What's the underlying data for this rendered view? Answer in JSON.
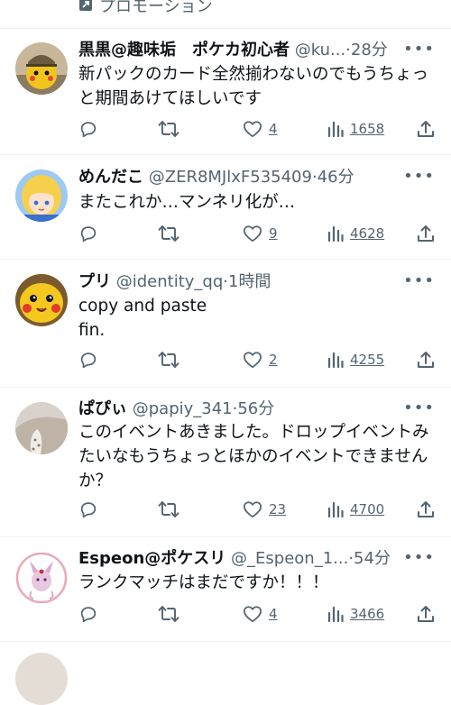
{
  "promo": {
    "label": "プロモーション"
  },
  "tweets": [
    {
      "name": "黒黒@趣味垢　ポケカ初心者",
      "meta": "@ku...·28分",
      "text": "新パックのカード全然揃わないのでもうちょっ\nと期間あけてほしいです",
      "likes": "4",
      "views": "1658",
      "avatar": "pikachu-plush"
    },
    {
      "name": "めんだこ",
      "meta": "@ZER8MJlxF535409·46分",
      "text": "またこれか…マンネリ化が…",
      "likes": "9",
      "views": "4628",
      "avatar": "anime-girl"
    },
    {
      "name": "プリ",
      "meta": "@identity_qq·1時間",
      "text": "copy and paste\nfin.",
      "likes": "2",
      "views": "4255",
      "avatar": "pikachu-face"
    },
    {
      "name": "ぱぴぃ",
      "meta": "@papiy_341·56分",
      "text": "このイベントあきました。ドロップイベントみ\nたいなもうちょっとほかのイベントできません\nか？",
      "likes": "23",
      "views": "4700",
      "avatar": "photo"
    },
    {
      "name": "Espeon@ポケスリ",
      "meta": "@_Espeon_1...·54分",
      "text": "ランクマッチはまだですか！！！",
      "likes": "4",
      "views": "3466",
      "avatar": "espeon"
    }
  ],
  "colors": {
    "text": "#0f1419",
    "secondary": "#536471",
    "divider": "#eff3f4"
  }
}
